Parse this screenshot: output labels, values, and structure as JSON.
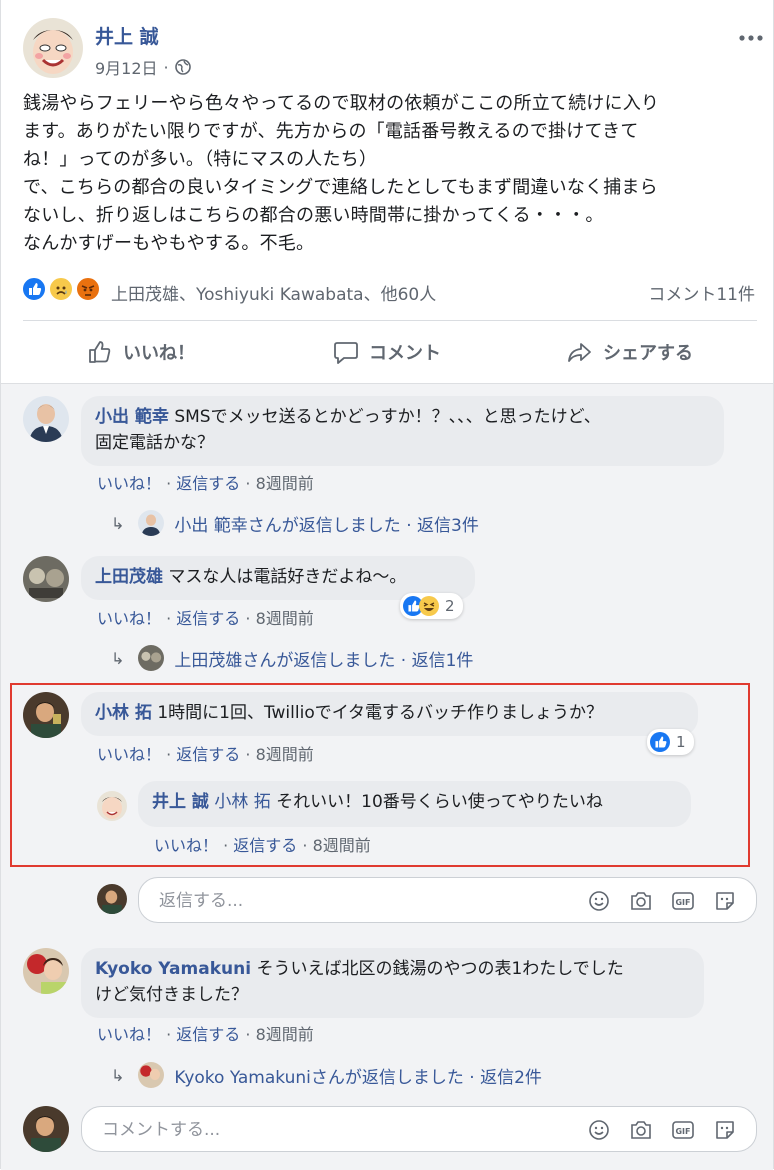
{
  "post": {
    "author": "井上 誠",
    "date": "9月12日",
    "privacy_icon": "globe-icon",
    "more_icon": "ellipsis-icon",
    "lines": [
      "銭湯やらフェリーやら色々やってるので取材の依頼がここの所立て続けに入り",
      "ます。ありがたい限りですが、先方からの「電話番号教えるので掛けてきて",
      "ね！」ってのが多い。（特にマスの人たち）",
      "で、こちらの都合の良いタイミングで連絡したとしてもまず間違いなく捕まら",
      "ないし、折り返しはこちらの都合の悪い時間帯に掛かってくる・・・。",
      "なんかすげーもやもやする。不毛。"
    ],
    "reactions_text": "上田茂雄、Yoshiyuki Kawabata、他60人",
    "comment_count": "コメント11件",
    "reaction_icons": [
      "like",
      "sad",
      "angry"
    ]
  },
  "actions": {
    "like": "いいね！",
    "comment": "コメント",
    "share": "シェアする"
  },
  "comments": [
    {
      "name": "小出 範幸",
      "text_line1": "SMSでメッセ送るとかどっすか！？、、、と思ったけど、",
      "text_line2": "固定電話かな？",
      "like": "いいね！",
      "reply": "返信する",
      "time": "8週間前",
      "replies_text": "小出 範幸さんが返信しました · 返信3件"
    },
    {
      "name": "上田茂雄",
      "text": "マスな人は電話好きだよね〜。",
      "like": "いいね！",
      "reply": "返信する",
      "time": "8週間前",
      "reaction_count": "2",
      "replies_text": "上田茂雄さんが返信しました · 返信1件"
    },
    {
      "name": "小林 拓",
      "text": "1時間に1回、Twillioでイタ電するバッチ作りましょうか？",
      "like": "いいね！",
      "reply": "返信する",
      "time": "8週間前",
      "reaction_count": "1",
      "nested_reply": {
        "name": "井上 誠",
        "mention": "小林 拓",
        "text": "それいい！10番号くらい使ってやりたいね",
        "like": "いいね！",
        "reply": "返信する",
        "time": "8週間前"
      }
    },
    {
      "name": "Kyoko Yamakuni",
      "text_line1": "そういえば北区の銭湯のやつの表1わたしでした",
      "text_line2": "けど気付きました？",
      "like": "いいね！",
      "reply": "返信する",
      "time": "8週間前",
      "replies_text": "Kyoko Yamakuniさんが返信しました · 返信2件"
    }
  ],
  "reply_input": {
    "placeholder": "返信する..."
  },
  "comment_input": {
    "placeholder": "コメントする..."
  },
  "input_icons": [
    "emoji-icon",
    "camera-icon",
    "gif-icon",
    "sticker-icon"
  ],
  "colors": {
    "link": "#385898",
    "meta": "#606770",
    "highlight": "#e03a2f",
    "like_blue": "#1877f2"
  }
}
